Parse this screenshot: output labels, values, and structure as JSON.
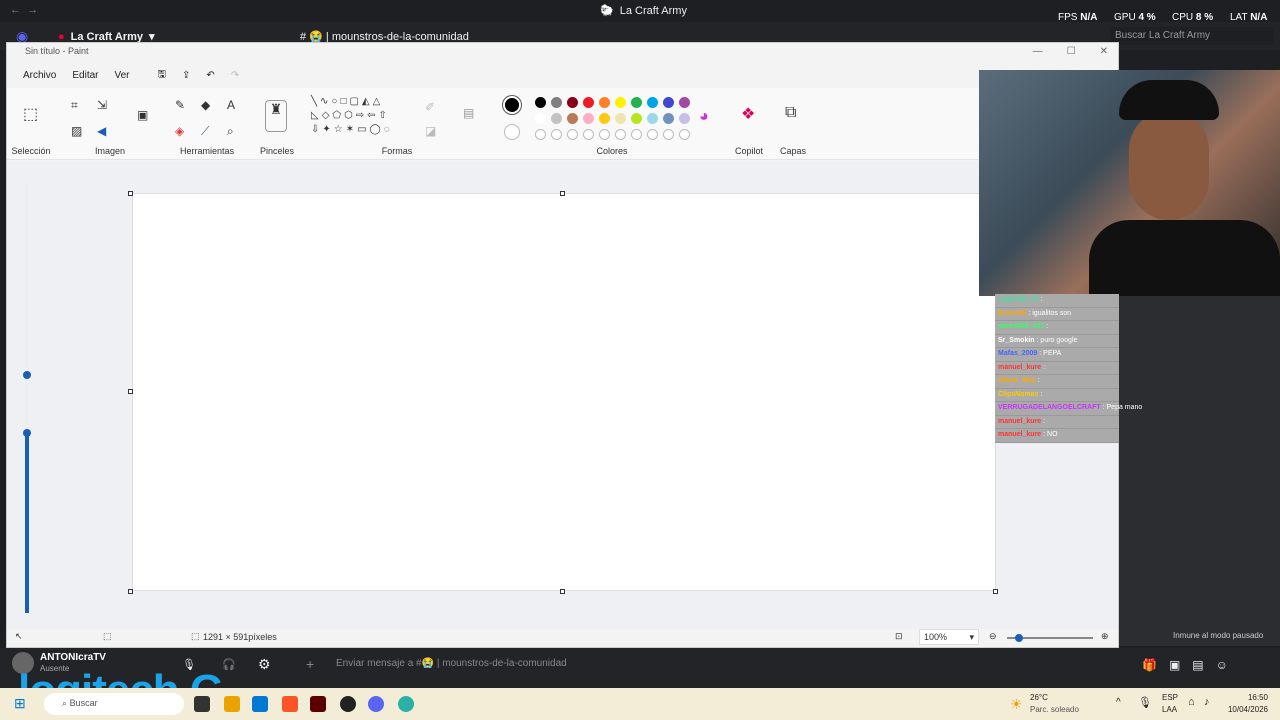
{
  "discord": {
    "window_title": "La Craft Army",
    "server_name": "La Craft Army",
    "channel": "mounstros-de-la-comunidad",
    "channel_prefix": "#",
    "search_placeholder": "Buscar La Craft Army",
    "stats": [
      {
        "label": "FPS",
        "value": "N/A"
      },
      {
        "label": "GPU",
        "value": "4 %"
      },
      {
        "label": "CPU",
        "value": "8 %"
      },
      {
        "label": "LAT",
        "value": "N/A"
      }
    ],
    "user": {
      "name": "ANTONIcraTV",
      "status": "Ausente"
    },
    "message_placeholder": "Enviar mensaje a #😭 | mounstros-de-la-comunidad",
    "right_status": "Inmune al modo pausado"
  },
  "paint": {
    "title": "Sin título - Paint",
    "menu": [
      "Archivo",
      "Editar",
      "Ver"
    ],
    "groups": {
      "seleccion": "Selección",
      "imagen": "Imagen",
      "herramientas": "Herramientas",
      "pinceles": "Pinceles",
      "formas": "Formas",
      "colores": "Colores",
      "copilot": "Copilot",
      "capas": "Capas"
    },
    "status": {
      "dimensions": "1291 × 591píxeles",
      "zoom": "100%"
    },
    "colors_row1": [
      "#000000",
      "#7f7f7f",
      "#880015",
      "#ed1c24",
      "#ff7f27",
      "#fff200",
      "#22b14c",
      "#00a2e8",
      "#3f48cc",
      "#a349a4"
    ],
    "colors_row2": [
      "#ffffff",
      "#c3c3c3",
      "#b97a57",
      "#ffaec9",
      "#ffc90e",
      "#efe4b0",
      "#b5e61d",
      "#99d9ea",
      "#7092be",
      "#c8bfe7"
    ]
  },
  "chat": [
    {
      "user": "Lagartija_01",
      "color": "#40e0a0",
      "text": ""
    },
    {
      "user": "Bruno48",
      "color": "#ffa500",
      "text": "igualitos son"
    },
    {
      "user": "shred456_431",
      "color": "#33ff66",
      "text": ""
    },
    {
      "user": "Sr_Smokin",
      "color": "#ffffff",
      "text": "puro google"
    },
    {
      "user": "Mafas_2009",
      "color": "#4466ff",
      "text": "PEPA"
    },
    {
      "user": "manuel_kure",
      "color": "#ff3333",
      "text": ""
    },
    {
      "user": "alison_Mey",
      "color": "#ffaa00",
      "text": ""
    },
    {
      "user": "ClipsNomas",
      "color": "#ffcc00",
      "text": ""
    },
    {
      "user": "VERRUGADELANGOELCRAFT",
      "color": "#cc33ff",
      "text": "Pepa mano"
    },
    {
      "user": "manuel_kure",
      "color": "#ff3333",
      "text": ""
    },
    {
      "user": "manuel_kure",
      "color": "#ff3333",
      "text": "NO"
    }
  ],
  "branding": {
    "logo": "logitech G"
  },
  "taskbar": {
    "search": "Buscar",
    "weather_temp": "26°C",
    "weather_desc": "Parc. soleado",
    "lang": "ESP",
    "lang2": "LAA",
    "time": "16:50",
    "date": "10/04/2026"
  }
}
